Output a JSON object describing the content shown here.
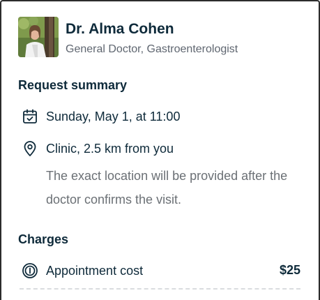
{
  "doctor": {
    "name": "Dr. Alma Cohen",
    "specialty": "General Doctor, Gastroenterologist",
    "avatar_icon": "doctor-portrait"
  },
  "request_summary": {
    "title": "Request summary",
    "date_icon": "calendar-check-icon",
    "date_text": "Sunday, May 1, at 11:00",
    "location_icon": "location-pin-icon",
    "location_text": "Clinic, 2.5 km from you",
    "location_note": "The exact location will be provided after the doctor confirms the visit."
  },
  "charges": {
    "title": "Charges",
    "items": [
      {
        "icon": "coin-icon",
        "label": "Appointment cost",
        "amount": "$25"
      }
    ]
  },
  "colors": {
    "heading": "#0e2a3a",
    "secondary": "#5f6670",
    "note": "#6b7075",
    "divider": "#d9dcdf",
    "frame": "#2c2c2c"
  }
}
